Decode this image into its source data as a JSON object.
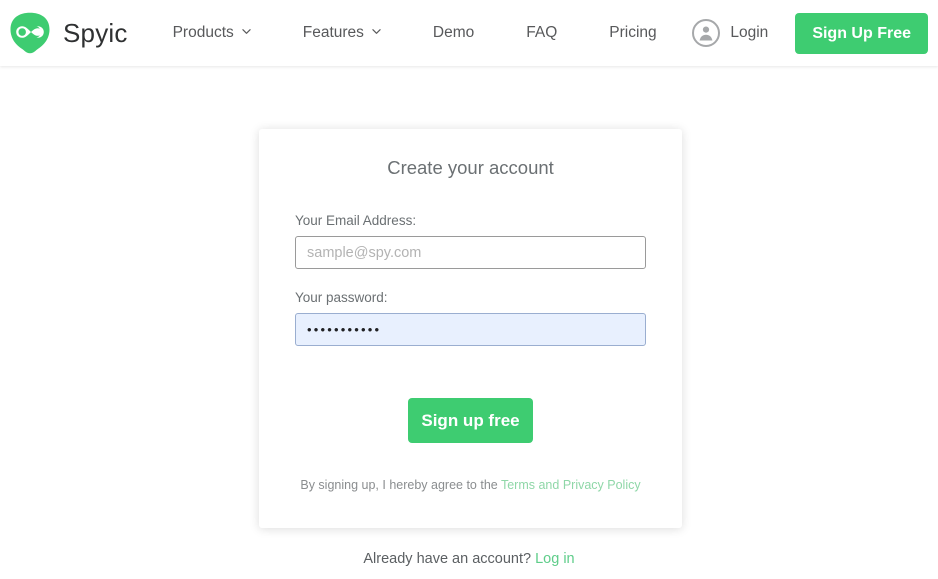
{
  "header": {
    "brand": {
      "name": "Spyic",
      "logo_icon": "infinity-shield-logo",
      "logo_color": "#3ECC71"
    },
    "nav": [
      {
        "label": "Products",
        "has_dropdown": true,
        "icon": "chevron-down-icon"
      },
      {
        "label": "Features",
        "has_dropdown": true,
        "icon": "chevron-down-icon"
      },
      {
        "label": "Demo",
        "has_dropdown": false
      },
      {
        "label": "FAQ",
        "has_dropdown": false
      },
      {
        "label": "Pricing",
        "has_dropdown": false
      }
    ],
    "login": {
      "label": "Login",
      "icon": "user-avatar-icon"
    },
    "signup_button": {
      "label": "Sign Up Free",
      "color": "#3ECC71"
    }
  },
  "card": {
    "title": "Create your account",
    "email_field": {
      "label": "Your Email Address:",
      "placeholder": "sample@spy.com",
      "value": ""
    },
    "password_field": {
      "label": "Your password:",
      "value": "•••••••••••",
      "autofilled": true,
      "autofill_background": "#e8f0fe"
    },
    "submit_button": {
      "label": "Sign up free",
      "color": "#3ECC71"
    },
    "terms": {
      "prefix": "By signing up, I hereby agree to the ",
      "link_label": "Terms and Privacy Policy",
      "link_color": "#8fd7a8"
    }
  },
  "footer": {
    "prompt": "Already have an account? ",
    "login_link": "Log in",
    "link_color": "#5fcd8a"
  }
}
